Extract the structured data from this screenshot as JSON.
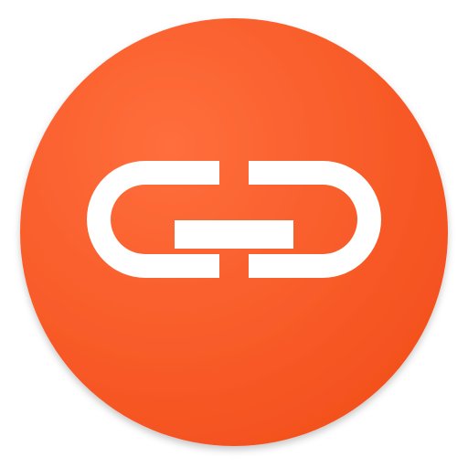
{
  "app_icon": {
    "icon": "link-icon",
    "colors": {
      "background": "#FF5722",
      "background_highlight": "#FF6E3C",
      "background_shade": "#F4511E",
      "glyph": "#FFFFFF"
    }
  }
}
